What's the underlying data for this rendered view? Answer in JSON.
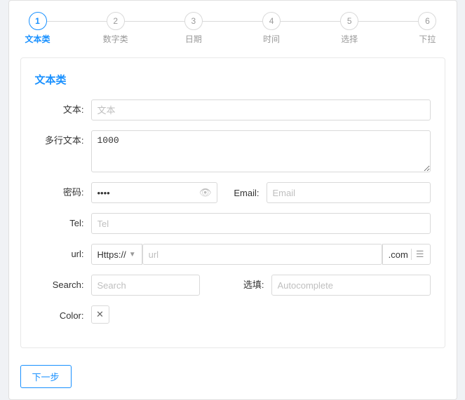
{
  "stepper": {
    "steps": [
      {
        "number": "1",
        "label": "文本类",
        "active": true
      },
      {
        "number": "2",
        "label": "数字类",
        "active": false
      },
      {
        "number": "3",
        "label": "日期",
        "active": false
      },
      {
        "number": "4",
        "label": "时间",
        "active": false
      },
      {
        "number": "5",
        "label": "选择",
        "active": false
      },
      {
        "number": "6",
        "label": "下拉",
        "active": false
      }
    ]
  },
  "card": {
    "title": "文本类"
  },
  "fields": {
    "text_label": "文本:",
    "text_placeholder": "文本",
    "multiline_label": "多行文本:",
    "multiline_value": "1000",
    "password_label": "密码:",
    "password_value": "••••",
    "email_label": "Email:",
    "email_placeholder": "Email",
    "tel_label": "Tel:",
    "tel_placeholder": "Tel",
    "url_label": "url:",
    "url_prefix": "Https://",
    "url_placeholder": "url",
    "url_suffix": ".com",
    "search_label": "Search:",
    "search_placeholder": "Search",
    "autocomplete_label": "选填:",
    "autocomplete_placeholder": "Autocomplete",
    "color_label": "Color:"
  },
  "buttons": {
    "next": "下一步"
  }
}
